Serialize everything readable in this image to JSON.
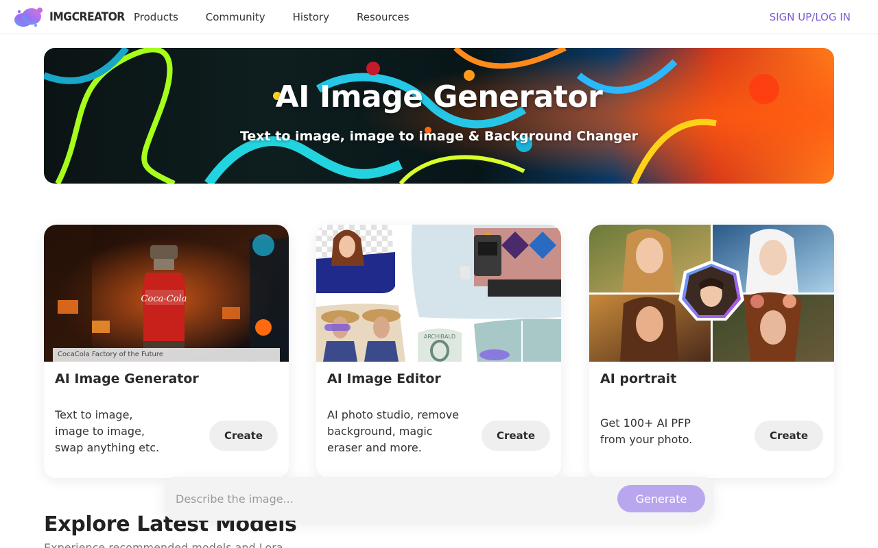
{
  "header": {
    "logo_text": "IMGCREATOR",
    "nav": [
      "Products",
      "Community",
      "History",
      "Resources"
    ],
    "auth_link": "SIGN UP/LOG IN"
  },
  "hero": {
    "title": "AI Image Generator",
    "subtitle": "Text to image, image to image & Background Changer"
  },
  "cards": [
    {
      "title": "AI Image Generator",
      "description": "Text to image,\nimage to image,\nswap anything etc.",
      "button": "Create",
      "caption": "CocaCola Factory of the Future"
    },
    {
      "title": "AI Image Editor",
      "description": "AI photo studio, remove\nbackground, magic\neraser and more.",
      "button": "Create",
      "caption": "ARCHIBALD"
    },
    {
      "title": "AI portrait",
      "description": "Get 100+ AI PFP\nfrom your photo.",
      "button": "Create"
    }
  ],
  "prompt": {
    "placeholder": "Describe the image...",
    "button": "Generate"
  },
  "explore": {
    "title": "Explore Latest Models",
    "subtitle": "Experience recommended models and Lora"
  },
  "colors": {
    "accent": "#7b5ad6",
    "generate_button": "#b9a6ef",
    "create_button": "#efefef"
  }
}
